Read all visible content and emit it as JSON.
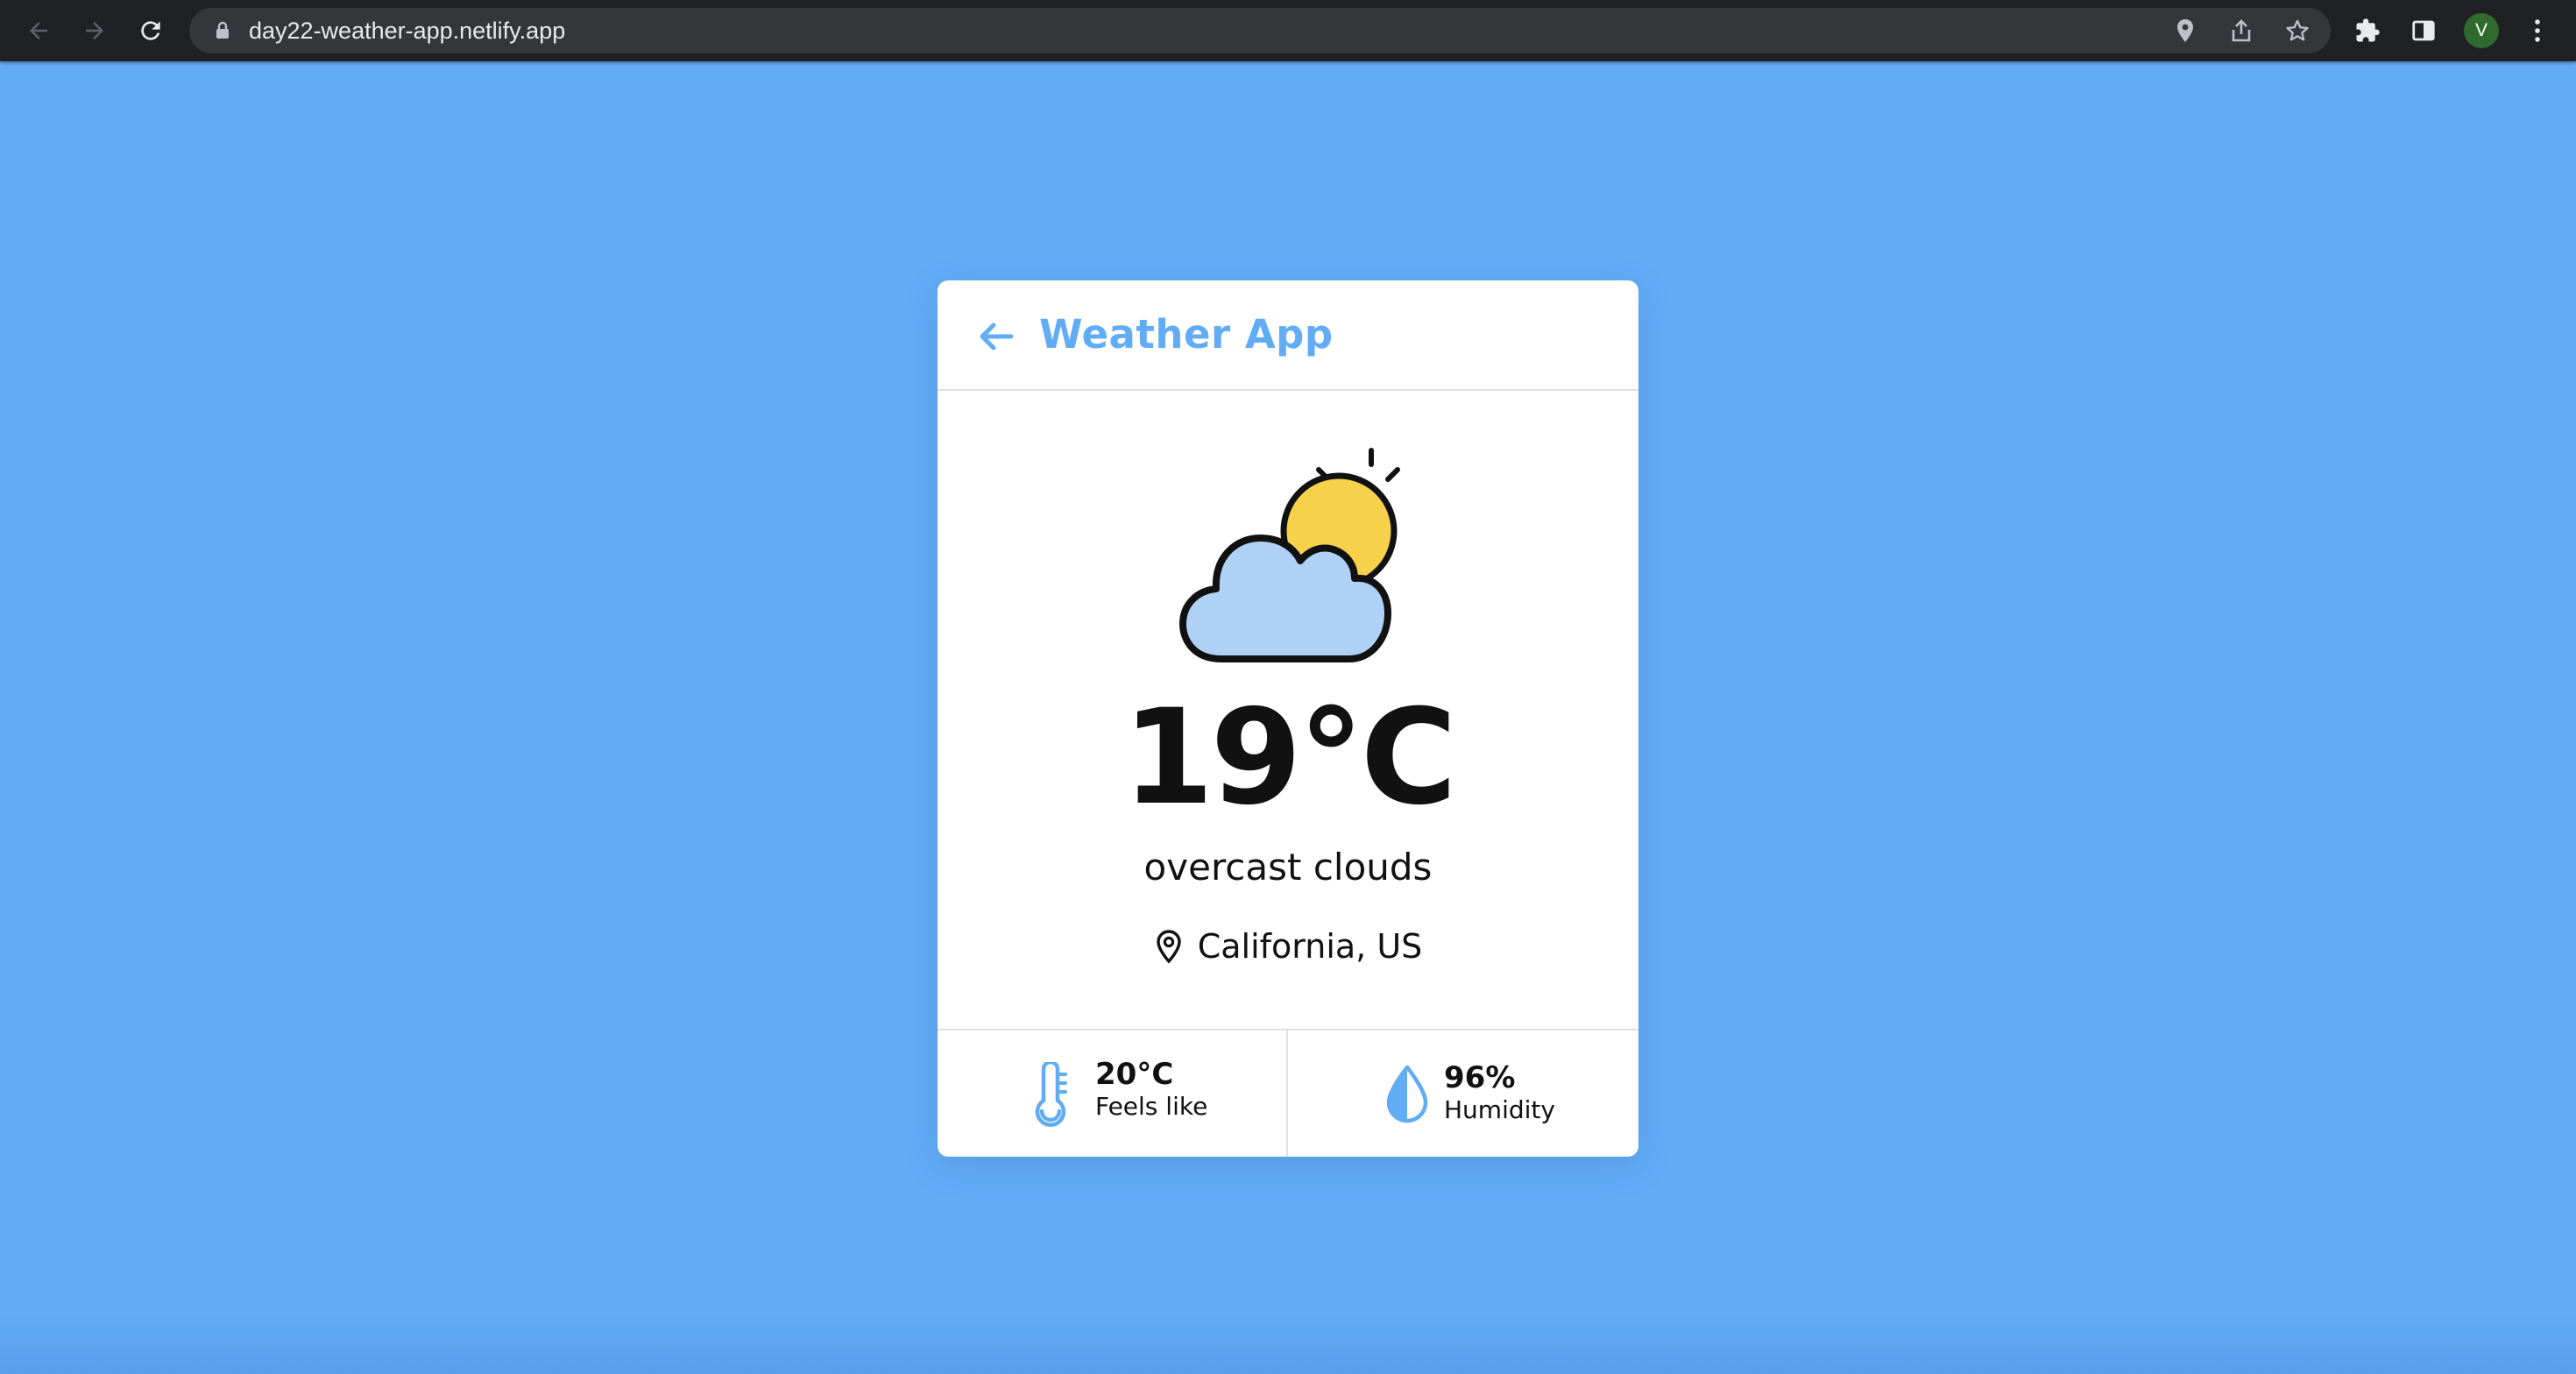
{
  "browser": {
    "url": "day22-weather-app.netlify.app",
    "profile_initial": "V",
    "icons": [
      "back-icon",
      "forward-icon",
      "reload-icon",
      "lock-icon",
      "location-icon",
      "share-icon",
      "bookmark-star-icon",
      "extensions-icon",
      "side-panel-icon",
      "menu-icon"
    ]
  },
  "app": {
    "title": "Weather App",
    "accent_color": "#62acf6",
    "background_color": "#62acf6"
  },
  "weather": {
    "icon": "sun-behind-cloud-icon",
    "temperature": "19°C",
    "description": "overcast clouds",
    "location": "California, US"
  },
  "stats": {
    "feels_like": {
      "icon": "thermometer-icon",
      "value": "20°C",
      "label": "Feels like"
    },
    "humidity": {
      "icon": "water-drop-icon",
      "value": "96%",
      "label": "Humidity"
    }
  }
}
